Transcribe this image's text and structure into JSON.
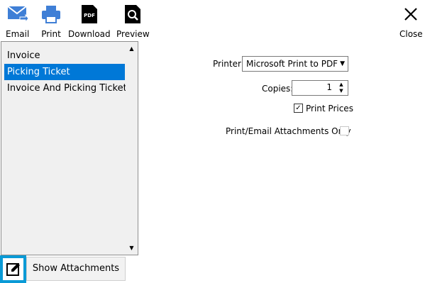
{
  "toolbar": {
    "email": {
      "label": "Email",
      "icon": "email-send-icon"
    },
    "print": {
      "label": "Print",
      "icon": "printer-icon"
    },
    "download": {
      "label": "Download",
      "icon": "pdf-download-icon"
    },
    "preview": {
      "label": "Preview",
      "icon": "preview-search-icon"
    },
    "close": {
      "label": "Close",
      "icon": "close-icon"
    }
  },
  "documents": {
    "items": [
      "Invoice",
      "Picking Ticket",
      "Invoice And Picking Ticket"
    ],
    "selected": "Picking Ticket"
  },
  "settings": {
    "printer_label": "Printer:",
    "printer_value": "Microsoft Print to PDF",
    "copies_label": "Copies:",
    "copies_value": "1",
    "print_prices_label": "Print Prices",
    "print_prices_checked": true,
    "attachments_only_label": "Print/Email Attachments Only",
    "attachments_only_checked": false
  },
  "footer": {
    "show_attachments_label": "Show Attachments"
  },
  "colors": {
    "accent": "#0078d7",
    "edit_button": "#0a9ad6",
    "icon_blue": "#3f7fd6"
  }
}
